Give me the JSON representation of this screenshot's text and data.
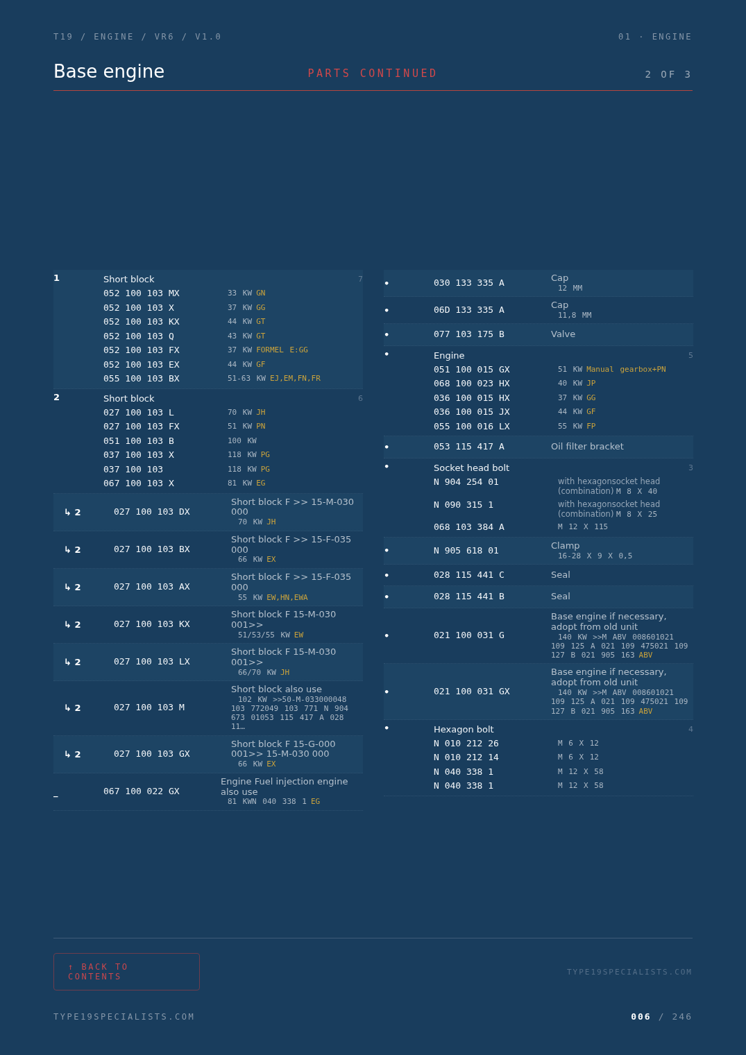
{
  "header": {
    "breadcrumb": "T19 / ENGINE / VR6 / V1.0",
    "section": "01 · ENGINE",
    "title": "Base engine",
    "subtitle": "PARTS CONTINUED",
    "page_of": "2 OF 3"
  },
  "columns": [
    {
      "entries": [
        {
          "kind": "group",
          "marker": "1",
          "title": "Short block",
          "count": "7",
          "items": [
            {
              "part": "052 100 103 MX",
              "spec": "33 KW",
              "code": "GN"
            },
            {
              "part": "052 100 103 X",
              "spec": "37 KW",
              "code": "GG"
            },
            {
              "part": "052 100 103 KX",
              "spec": "44 KW",
              "code": "GT"
            },
            {
              "part": "052 100 103 Q",
              "spec": "43 KW",
              "code": "GT"
            },
            {
              "part": "052 100 103 FX",
              "spec": "37 KW",
              "code": "FORMEL E:GG"
            },
            {
              "part": "052 100 103 EX",
              "spec": "44 KW",
              "code": "GF"
            },
            {
              "part": "055 100 103 BX",
              "spec": "51-63 KW",
              "code": "EJ,EM,FN,FR"
            }
          ]
        },
        {
          "kind": "group",
          "marker": "2",
          "title": "Short block",
          "count": "6",
          "items": [
            {
              "part": "027 100 103 L",
              "spec": "70 KW",
              "code": "JH"
            },
            {
              "part": "027 100 103 FX",
              "spec": "51 KW",
              "code": "PN"
            },
            {
              "part": "051 100 103 B",
              "spec": "100 KW"
            },
            {
              "part": "037 100 103 X",
              "spec": "118 KW",
              "code": "PG"
            },
            {
              "part": "037 100 103",
              "spec": "118 KW",
              "code": "PG"
            },
            {
              "part": "067 100 103 X",
              "spec": "81 KW",
              "code": "EG"
            }
          ]
        },
        {
          "kind": "sub",
          "marker": "↳ 2",
          "part": "027 100 103 DX",
          "desc": "Short block F >> 15-M-030 000",
          "spec": "70 KW",
          "code": "JH"
        },
        {
          "kind": "sub",
          "marker": "↳ 2",
          "part": "027 100 103 BX",
          "desc": "Short block F >> 15-F-035 000",
          "spec": "66 KW",
          "code": "EX"
        },
        {
          "kind": "sub",
          "marker": "↳ 2",
          "part": "027 100 103 AX",
          "desc": "Short block F >> 15-F-035 000",
          "spec": "55 KW",
          "code": "EW,HN,EWA"
        },
        {
          "kind": "sub",
          "marker": "↳ 2",
          "part": "027 100 103 KX",
          "desc": "Short block F 15-M-030 001>>",
          "spec": "51/53/55 KW",
          "code": "EW"
        },
        {
          "kind": "sub",
          "marker": "↳ 2",
          "part": "027 100 103 LX",
          "desc": "Short block F 15-M-030 001>>",
          "spec": "66/70 KW",
          "code": "JH"
        },
        {
          "kind": "sub",
          "marker": "↳ 2",
          "part": "027 100 103 M",
          "desc": "Short block also use",
          "spec": "102 KW >>50-M-033000048 103 772049 103 771 N 904 673 01053 115 417 A 028 11…"
        },
        {
          "kind": "sub",
          "marker": "↳ 2",
          "part": "027 100 103 GX",
          "desc": "Short block F 15-G-000 001>> 15-M-030 000",
          "spec": "66 KW",
          "code": "EX"
        },
        {
          "kind": "single",
          "marker": "_",
          "part": "067 100 022 GX",
          "desc": "Engine Fuel injection engine also use",
          "spec": "81 KWN 040 338 1",
          "code": "EG"
        }
      ]
    },
    {
      "entries": [
        {
          "kind": "single",
          "marker": "•",
          "part": "030 133 335 A",
          "desc": "Cap",
          "spec": "12 MM"
        },
        {
          "kind": "single",
          "marker": "•",
          "part": "06D 133 335 A",
          "desc": "Cap",
          "spec": "11,8 MM"
        },
        {
          "kind": "single",
          "marker": "•",
          "part": "077 103 175 B",
          "desc": "Valve"
        },
        {
          "kind": "group",
          "marker": "•",
          "title": "Engine",
          "count": "5",
          "items": [
            {
              "part": "051 100 015 GX",
              "spec": "51 KW",
              "code": "Manual gearbox+PN"
            },
            {
              "part": "068 100 023 HX",
              "spec": "40 KW",
              "code": "JP"
            },
            {
              "part": "036 100 015 HX",
              "spec": "37 KW",
              "code": "GG"
            },
            {
              "part": "036 100 015 JX",
              "spec": "44 KW",
              "code": "GF"
            },
            {
              "part": "055 100 016 LX",
              "spec": "55 KW",
              "code": "FP"
            }
          ]
        },
        {
          "kind": "single",
          "marker": "•",
          "part": "053 115 417 A",
          "desc": "Oil filter bracket"
        },
        {
          "kind": "group",
          "marker": "•",
          "title": "Socket head bolt",
          "count": "3",
          "items": [
            {
              "part": "N 904 254 01",
              "note": "with hexagonsocket head (combination)",
              "spec": "M 8 X 40"
            },
            {
              "part": "N 090 315 1",
              "note": "with hexagonsocket head (combination)",
              "spec": "M 8 X 25"
            },
            {
              "part": "068 103 384 A",
              "spec": "M 12 X 115"
            }
          ]
        },
        {
          "kind": "single",
          "marker": "•",
          "part": "N 905 618 01",
          "desc": "Clamp",
          "spec": "16-28 X 9 X 0,5"
        },
        {
          "kind": "single",
          "marker": "•",
          "part": "028 115 441 C",
          "desc": "Seal"
        },
        {
          "kind": "single",
          "marker": "•",
          "part": "028 115 441 B",
          "desc": "Seal"
        },
        {
          "kind": "single",
          "marker": "•",
          "part": "021 100 031 G",
          "desc": "Base engine if necessary, adopt from old unit",
          "spec": "140 KW >>M ABV 008601021 109 125 A 021 109 475021 109 127 B 021 905 163",
          "code": "ABV"
        },
        {
          "kind": "single",
          "marker": "•",
          "part": "021 100 031 GX",
          "desc": "Base engine if necessary, adopt from old unit",
          "spec": "140 KW >>M ABV 008601021 109 125 A 021 109 475021 109 127 B 021 905 163",
          "code": "ABV"
        },
        {
          "kind": "group",
          "marker": "•",
          "title": "Hexagon bolt",
          "count": "4",
          "items": [
            {
              "part": "N 010 212 26",
              "spec": "M 6 X 12"
            },
            {
              "part": "N 010 212 14",
              "spec": "M 6 X 12"
            },
            {
              "part": "N 040 338 1",
              "spec": "M 12 X 58"
            },
            {
              "part": "N 040 338 1",
              "spec": "M 12 X 58"
            }
          ]
        }
      ]
    }
  ],
  "footer": {
    "button": "↑ BACK TO CONTENTS",
    "site_right": "TYPE19SPECIALISTS.COM",
    "site_left": "TYPE19SPECIALISTS.COM",
    "page_current": "006",
    "page_separator": "/",
    "page_total": "246"
  }
}
